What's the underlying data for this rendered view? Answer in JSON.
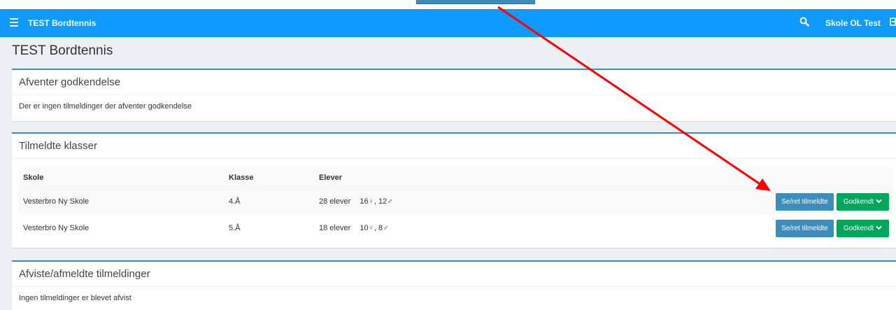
{
  "navbar": {
    "brand": "TEST Bordtennis",
    "user": "Skole OL Test",
    "menu_icon": "hamburger-icon",
    "search_icon": "search-icon",
    "logout_icon": "logout-icon",
    "color": "#0f9aff"
  },
  "page": {
    "title": "TEST Bordtennis"
  },
  "pending_box": {
    "title": "Afventer godkendelse",
    "message": "Der er ingen tilmeldinger der afventer godkendelse"
  },
  "classes_box": {
    "title": "Tilmeldte klasser",
    "columns": [
      "Skole",
      "Klasse",
      "Elever"
    ],
    "rows": [
      {
        "school": "Vesterbro Ny Skole",
        "class": "4.Å",
        "students": "28 elever",
        "female": "16",
        "male": "12",
        "view_label": "Se/ret tilmeldte",
        "status_label": "Godkendt"
      },
      {
        "school": "Vesterbro Ny Skole",
        "class": "5.Å",
        "students": "18 elever",
        "female": "10",
        "male": "8",
        "view_label": "Se/ret tilmeldte",
        "status_label": "Godkendt"
      }
    ]
  },
  "rejected_box": {
    "title": "Afviste/afmeldte tilmeldinger",
    "message": "Ingen tilmeldinger er blevet afvist"
  },
  "colors": {
    "primary": "#3c8dbc",
    "success": "#00a65a",
    "annotation_arrow": "#ff0000",
    "female": "#e8412c",
    "male": "#1b3fa8"
  }
}
